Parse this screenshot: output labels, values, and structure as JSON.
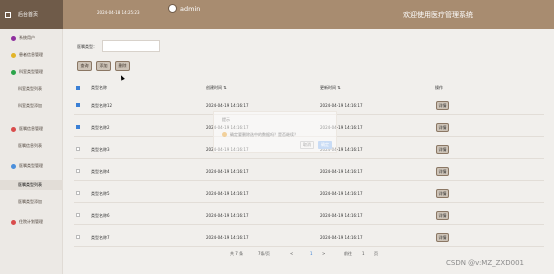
{
  "header": {
    "sidebar_title": "后台首页",
    "datetime": "2024-04-18 14:25:23",
    "user": "admin",
    "welcome": "欢迎使用医疗管理系统"
  },
  "sidebar": {
    "items": [
      {
        "label": "系统用户",
        "icon_color": "#8f2f9f"
      },
      {
        "label": "患者信息管理",
        "icon_color": "#e2b429"
      },
      {
        "label": "科室类型管理",
        "icon_color": "#2ca44a"
      },
      {
        "label": "科室类型列表",
        "icon_color": ""
      },
      {
        "label": "科室类型添加",
        "icon_color": ""
      },
      {
        "label": "医嘱信息管理",
        "icon_color": "#d94c4c"
      },
      {
        "label": "医嘱信息列表",
        "icon_color": ""
      },
      {
        "label": "医嘱类型管理",
        "icon_color": "#4b8fdc"
      },
      {
        "label": "医嘱类型列表",
        "icon_color": ""
      },
      {
        "label": "医嘱类型添加",
        "icon_color": ""
      },
      {
        "label": "住院计划管理",
        "icon_color": "#d94c4c"
      }
    ]
  },
  "search": {
    "label": "医嘱类型：",
    "value": ""
  },
  "buttons": {
    "query": "查询",
    "add": "添加",
    "delete": "删除"
  },
  "table": {
    "headers": [
      "类型名称",
      "创建时间 ⇅",
      "更新时间 ⇅",
      "操作"
    ],
    "rows": [
      {
        "name": "类型名称12",
        "created": "2024-04-19 14:16:17",
        "updated": "2024-04-19 14:16:17",
        "action": "详情",
        "checked": true
      },
      {
        "name": "类型名称2",
        "created": "2024-04-19 14:16:17",
        "updated": "2024-04-19 14:16:17",
        "action": "详情",
        "checked": true
      },
      {
        "name": "类型名称3",
        "created": "2024-04-19 14:16:17",
        "updated": "2024-04-19 14:16:17",
        "action": "详情",
        "checked": false
      },
      {
        "name": "类型名称4",
        "created": "2024-04-19 14:16:17",
        "updated": "2024-04-19 14:16:17",
        "action": "详情",
        "checked": false
      },
      {
        "name": "类型名称5",
        "created": "2024-04-19 14:16:17",
        "updated": "2024-04-19 14:16:17",
        "action": "详情",
        "checked": false
      },
      {
        "name": "类型名称6",
        "created": "2024-04-19 14:16:17",
        "updated": "2024-04-19 14:16:17",
        "action": "详情",
        "checked": false
      },
      {
        "name": "类型名称7",
        "created": "2024-04-19 14:16:17",
        "updated": "2024-04-19 14:16:17",
        "action": "详情",
        "checked": false
      }
    ]
  },
  "dialog": {
    "title": "提示",
    "message": "确定要删除选中的数据吗？是否继续？",
    "cancel": "取消",
    "ok": "确定"
  },
  "pager": {
    "total": "共 7 条",
    "page_size": "7条/页",
    "prev": "<",
    "page": "1",
    "next": ">",
    "goto": "前往",
    "goto_page": "1",
    "unit": "页"
  },
  "watermark": "CSDN @v:MZ_ZXD001"
}
